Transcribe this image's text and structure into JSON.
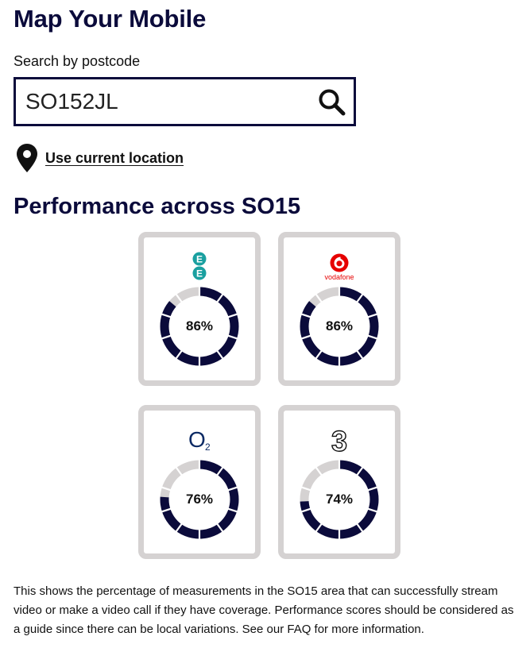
{
  "header": {
    "title": "Map Your Mobile"
  },
  "search": {
    "label": "Search by postcode",
    "value": "SO152JL"
  },
  "location": {
    "link_label": "Use current location"
  },
  "performance": {
    "title": "Performance across SO15",
    "operators": [
      {
        "logo_icon": "ee-logo-icon",
        "brand_color": "#1aa0a0",
        "percent": 86,
        "percent_label": "86%"
      },
      {
        "logo_icon": "vodafone-logo-icon",
        "logo_text": "vodafone",
        "brand_color": "#e60000",
        "percent": 86,
        "percent_label": "86%"
      },
      {
        "logo_icon": "o2-logo-icon",
        "logo_text": "O",
        "logo_sub": "2",
        "brand_color": "#0c2a64",
        "percent": 76,
        "percent_label": "76%"
      },
      {
        "logo_icon": "three-logo-icon",
        "logo_text": "3",
        "brand_color": "#111111",
        "percent": 74,
        "percent_label": "74%"
      }
    ]
  },
  "colors": {
    "ring_fill": "#0b0b3b",
    "ring_track": "#d5d2d2",
    "card_border": "#d5d2d2",
    "heading": "#0b0b3b"
  },
  "footnote": "This shows the percentage of measurements in the SO15 area that can successfully stream video or make a video call if they have coverage. Performance scores should be considered as a guide since there can be local variations. See our FAQ for more information."
}
